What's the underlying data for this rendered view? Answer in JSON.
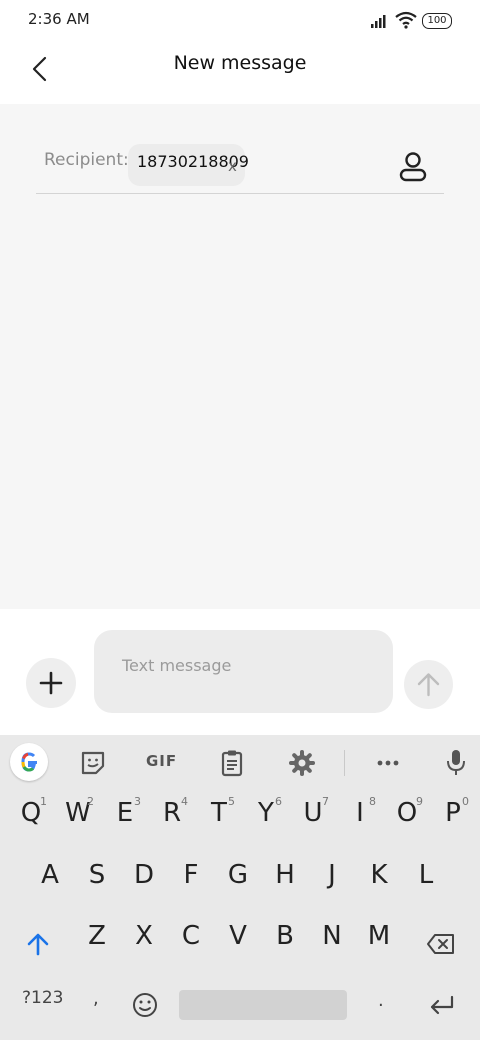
{
  "status_bar": {
    "time": "2:36 AM",
    "battery": "100"
  },
  "header": {
    "title": "New message"
  },
  "recipient": {
    "label": "Recipient:",
    "chip": "18730218809",
    "remove": "x"
  },
  "composer": {
    "placeholder": "Text message"
  },
  "keyboard": {
    "gif_label": "GIF",
    "row1": [
      {
        "key": "Q",
        "hint": "1"
      },
      {
        "key": "W",
        "hint": "2"
      },
      {
        "key": "E",
        "hint": "3"
      },
      {
        "key": "R",
        "hint": "4"
      },
      {
        "key": "T",
        "hint": "5"
      },
      {
        "key": "Y",
        "hint": "6"
      },
      {
        "key": "U",
        "hint": "7"
      },
      {
        "key": "I",
        "hint": "8"
      },
      {
        "key": "O",
        "hint": "9"
      },
      {
        "key": "P",
        "hint": "0"
      }
    ],
    "row2": [
      "A",
      "S",
      "D",
      "F",
      "G",
      "H",
      "J",
      "K",
      "L"
    ],
    "row3": [
      "Z",
      "X",
      "C",
      "V",
      "B",
      "N",
      "M"
    ],
    "sym": "?123",
    "comma": ",",
    "period": "."
  },
  "colors": {
    "shift_arrow": "#1a73e8",
    "compose_bg": "#f6f6f6",
    "keyboard_bg": "#e9e9e9"
  },
  "icons": [
    "back-arrow-icon",
    "contact-icon",
    "plus-icon",
    "send-arrow-icon",
    "google-icon",
    "sticker-icon",
    "clipboard-icon",
    "gear-icon",
    "more-icon",
    "mic-icon",
    "shift-icon",
    "backspace-icon",
    "emoji-icon",
    "enter-icon"
  ]
}
